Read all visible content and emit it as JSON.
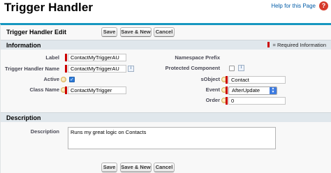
{
  "header": {
    "title": "Trigger Handler",
    "help_link": "Help for this Page",
    "help_icon": "?"
  },
  "edit": {
    "title": "Trigger Handler Edit",
    "buttons": {
      "save": "Save",
      "save_new": "Save & New",
      "cancel": "Cancel"
    }
  },
  "information": {
    "title": "Information",
    "required_note": "= Required Information",
    "fields": {
      "label": {
        "label": "Label",
        "value": "ContactMyTriggerAU"
      },
      "handler_name": {
        "label": "Trigger Handler Name",
        "value": "ContactMyTriggerAU"
      },
      "active": {
        "label": "Active",
        "checked": true
      },
      "class_name": {
        "label": "Class Name",
        "value": "ContactMyTrigger"
      },
      "namespace_prefix": {
        "label": "Namespace Prefix",
        "value": ""
      },
      "protected_component": {
        "label": "Protected Component",
        "checked": false
      },
      "sobject": {
        "label": "sObject",
        "value": "Contact"
      },
      "event": {
        "label": "Event",
        "value": "AfterUpdate"
      },
      "order": {
        "label": "Order",
        "value": "0"
      }
    }
  },
  "description": {
    "title": "Description",
    "label": "Description",
    "value": "Runs my great logic on Contacts"
  },
  "colors": {
    "accent": "#1797c0",
    "required": "#cc0000",
    "section_bg": "#e0e7ec",
    "select_arrow": "#3d7be0"
  }
}
